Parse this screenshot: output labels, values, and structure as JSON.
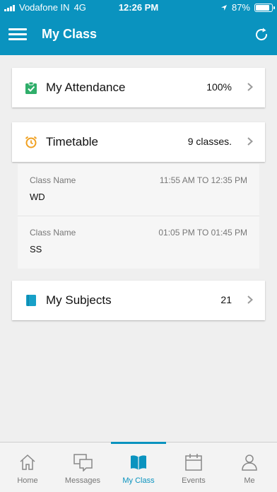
{
  "status_bar": {
    "carrier": "Vodafone IN",
    "network": "4G",
    "time": "12:26 PM",
    "battery": "87%",
    "battery_level": 0.87
  },
  "header": {
    "title": "My Class"
  },
  "attendance": {
    "title": "My Attendance",
    "value": "100%"
  },
  "timetable": {
    "title": "Timetable",
    "value": "9 classes.",
    "items": [
      {
        "label": "Class Name",
        "time": "11:55 AM TO 12:35 PM",
        "name": "WD"
      },
      {
        "label": "Class Name",
        "time": "01:05 PM TO 01:45 PM",
        "name": "SS"
      }
    ]
  },
  "subjects": {
    "title": "My Subjects",
    "value": "21"
  },
  "tabs": [
    {
      "label": "Home",
      "icon": "home-icon"
    },
    {
      "label": "Messages",
      "icon": "messages-icon"
    },
    {
      "label": "My Class",
      "icon": "book-icon",
      "active": true
    },
    {
      "label": "Events",
      "icon": "calendar-icon"
    },
    {
      "label": "Me",
      "icon": "person-icon"
    }
  ],
  "colors": {
    "brand": "#0a93bf",
    "attendance_icon": "#2fae6a",
    "timetable_icon": "#f0a020",
    "subjects_icon": "#17a0c8"
  }
}
